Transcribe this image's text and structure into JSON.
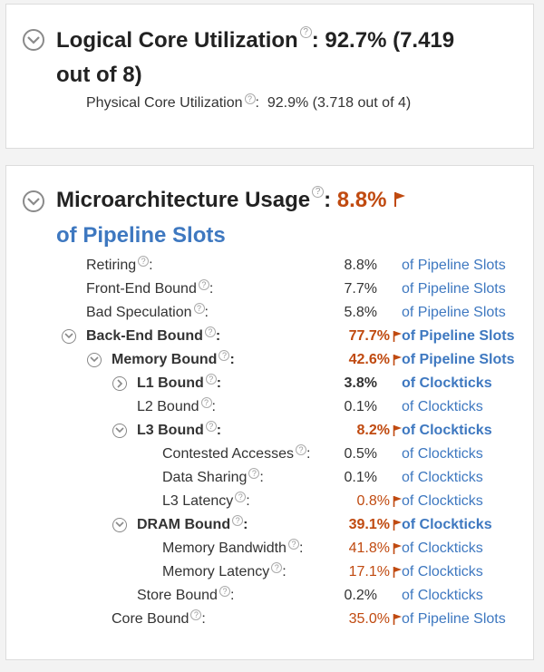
{
  "panel1": {
    "title": "Logical Core Utilization",
    "colon": ":",
    "value": "92.7% (7.419",
    "value_line2": "out of 8)",
    "sub_label": "Physical Core Utilization",
    "sub_colon": ":",
    "sub_value": "92.9% (3.718 out of 4)"
  },
  "panel2": {
    "title": "Microarchitecture Usage",
    "colon": ":",
    "value": "8.8%",
    "unit": "of Pipeline Slots"
  },
  "help_glyph": "?",
  "rows": [
    {
      "label": "Retiring",
      "value": "8.8%",
      "unit": "of Pipeline Slots"
    },
    {
      "label": "Front-End Bound",
      "value": "7.7%",
      "unit": "of Pipeline Slots"
    },
    {
      "label": "Bad Speculation",
      "value": "5.8%",
      "unit": "of Pipeline Slots"
    },
    {
      "label": "Back-End Bound",
      "value": "77.7%",
      "unit": "of Pipeline Slots"
    },
    {
      "label": "Memory Bound",
      "value": "42.6%",
      "unit": "of Pipeline Slots"
    },
    {
      "label": "L1 Bound",
      "value": "3.8%",
      "unit": "of Clockticks"
    },
    {
      "label": "L2 Bound",
      "value": "0.1%",
      "unit": "of Clockticks"
    },
    {
      "label": "L3 Bound",
      "value": "8.2%",
      "unit": "of Clockticks"
    },
    {
      "label": "Contested Accesses",
      "value": "0.5%",
      "unit": "of Clockticks"
    },
    {
      "label": "Data Sharing",
      "value": "0.1%",
      "unit": "of Clockticks"
    },
    {
      "label": "L3 Latency",
      "value": "0.8%",
      "unit": "of Clockticks"
    },
    {
      "label": "DRAM Bound",
      "value": "39.1%",
      "unit": "of Clockticks"
    },
    {
      "label": "Memory Bandwidth",
      "value": "41.8%",
      "unit": "of Clockticks"
    },
    {
      "label": "Memory Latency",
      "value": "17.1%",
      "unit": "of Clockticks"
    },
    {
      "label": "Store Bound",
      "value": "0.2%",
      "unit": "of Clockticks"
    },
    {
      "label": "Core Bound",
      "value": "35.0%",
      "unit": "of Pipeline Slots"
    }
  ],
  "row_colon": ":",
  "colors": {
    "accent": "#c04a10",
    "link": "#3e78c0"
  }
}
